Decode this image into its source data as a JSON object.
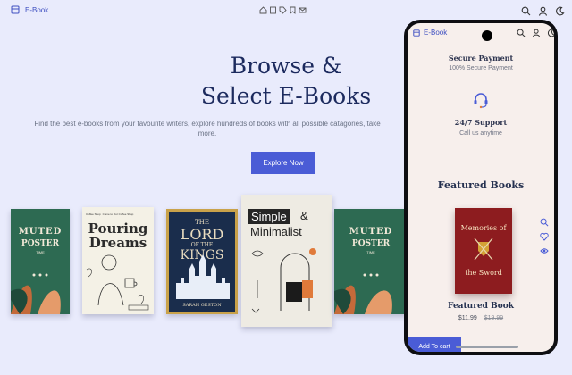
{
  "header": {
    "logo_text": "E-Book",
    "center_icons": [
      "home-icon",
      "book-icon",
      "tag-icon",
      "bookmark-icon",
      "mail-icon"
    ],
    "right_icons": [
      "search-icon",
      "user-icon",
      "moon-icon"
    ]
  },
  "hero": {
    "title_line1": "Browse &",
    "title_line2": "Select E-Books",
    "subtitle_line1": "Find the best e-books from your favourite writers, explore hundreds of books with all possible catagories, take",
    "subtitle_line2": "more.",
    "cta_label": "Explore Now"
  },
  "books": [
    {
      "title_top": "MUTED",
      "title_small": "POSTER",
      "title_main": "TIME"
    },
    {
      "kicker": "Come to Our Coffee Shop",
      "tag": "Coffee Shop",
      "title": "Pouring Dreams"
    },
    {
      "title_top": "THE",
      "title_main": "LORD",
      "title_mid": "OF THE",
      "title_end": "KINGS",
      "author": "SARAH GESTON"
    },
    {
      "title_line1": "Simple",
      "title_amp": "&",
      "title_line2": "Minimalist"
    },
    {
      "title_top": "MUTED",
      "title_small": "POSTER",
      "title_main": "TIME"
    }
  ],
  "phone": {
    "logo_text": "E-Book",
    "secure_title": "Secure Payment",
    "secure_sub": "100% Secure Payment",
    "support_title": "24/7 Support",
    "support_sub": "Call us anytime",
    "featured_heading": "Featured Books",
    "featured_book": {
      "cover_line1": "Memories of",
      "cover_line2": "the Sword",
      "name": "Featured Book",
      "price": "$11.99",
      "old_price": "$19.99"
    },
    "add_to_cart_label": "Add To cart"
  },
  "colors": {
    "accent": "#4a5cd6",
    "title": "#1c2a5e",
    "page_bg": "#e9ebfc",
    "phone_bg": "#f7efec"
  }
}
